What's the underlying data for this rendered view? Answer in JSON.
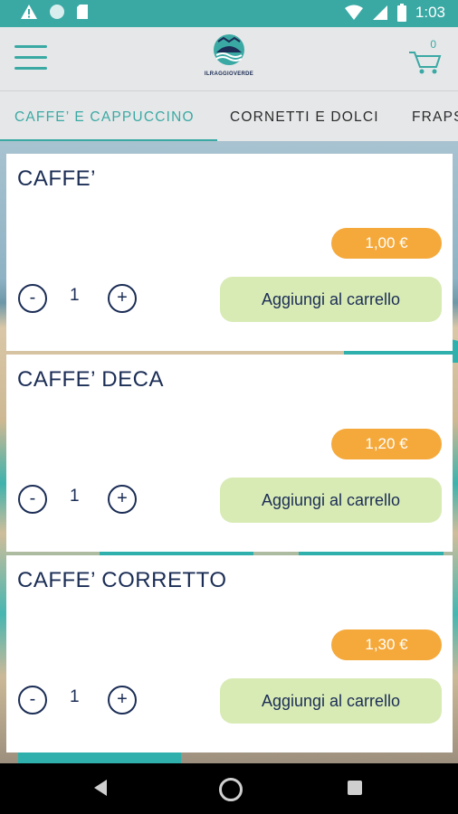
{
  "status_bar": {
    "time": "1:03",
    "icons": [
      "warning-icon",
      "circle-icon",
      "sd-card-icon",
      "wifi-icon",
      "signal-icon",
      "battery-icon"
    ]
  },
  "app_bar": {
    "logo_text": "ILRAGGIOVERDE",
    "cart_count": "0"
  },
  "tabs": [
    {
      "label": "CAFFE’ E CAPPUCCINO",
      "active": true
    },
    {
      "label": "CORNETTI E DOLCI",
      "active": false
    },
    {
      "label": "FRAPS",
      "active": false
    }
  ],
  "products": [
    {
      "name": "CAFFE’",
      "price": "1,00 €",
      "qty": "1",
      "minus": "-",
      "plus": "+",
      "add_label": "Aggiungi al carrello"
    },
    {
      "name": "CAFFE’ DECA",
      "price": "1,20 €",
      "qty": "1",
      "minus": "-",
      "plus": "+",
      "add_label": "Aggiungi al carrello"
    },
    {
      "name": "CAFFE’ CORRETTO",
      "price": "1,30 €",
      "qty": "1",
      "minus": "-",
      "plus": "+",
      "add_label": "Aggiungi al carrello"
    }
  ],
  "colors": {
    "accent": "#3aa9a4",
    "price_bg": "#f5a93b",
    "add_button_bg": "#d8ebb5",
    "text_dark": "#1b2d55"
  }
}
